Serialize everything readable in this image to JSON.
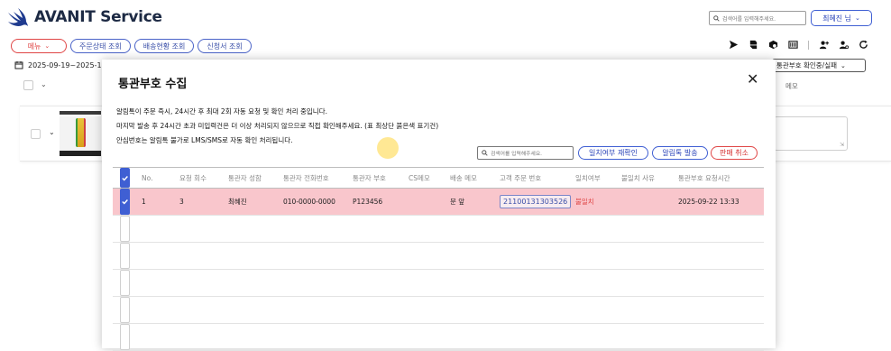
{
  "header": {
    "app_title": "AVANIT Service",
    "search_placeholder": "검색어를 입력해주세요.",
    "user_label": "최혜진 님"
  },
  "nav": {
    "menu_label": "메뉴",
    "pills": [
      "주문상태 조회",
      "배송현황 조회",
      "신청서 조회"
    ]
  },
  "toolbar": {
    "icons": [
      "send-icon",
      "print-icon",
      "package-search-icon",
      "barcode-icon",
      "user-add-icon",
      "user-settings-icon",
      "refresh-icon"
    ]
  },
  "filters": {
    "date_range": "2025-09-19~2025-1",
    "status_select": "통관부호 확인중/실패",
    "memo_label": "메모"
  },
  "modal": {
    "title": "통관부호 수집",
    "notices": [
      "알림톡이 주문 즉시, 24시간 후 최대 2회 자동 요청 및 확인 처리 중입니다.",
      "마지막 발송 후 24시간 초과 미입력건은 더 이상 처리되지 않으므로 직접 확인해주세요. (표 최상단 붉은색 표기건)",
      "안심번호는 알림톡 불가로 LMS/SMS로 자동 확인 처리됩니다."
    ],
    "search_placeholder": "검색어를 입력해주세요.",
    "buttons": {
      "recheck": "일치여부 재확인",
      "send_alimtalk": "알림톡 발송",
      "cancel_sale": "판매 취소"
    },
    "columns": [
      "No.",
      "요청 회수",
      "통관자 성함",
      "통관자 전화번호",
      "통관자 부호",
      "CS메모",
      "배송 메모",
      "고객 주문 번호",
      "일치여부",
      "불일치 사유",
      "통관부호 요청시간"
    ],
    "rows": [
      {
        "checked": true,
        "no": "1",
        "request_count": "3",
        "name": "최혜진",
        "phone": "010-0000-0000",
        "code": "P123456",
        "cs_memo": "",
        "delivery_memo": "문 앞",
        "order_no": "21100131303526",
        "match": "불일치",
        "mismatch_reason": "",
        "requested_at": "2025-09-22 13:33"
      }
    ]
  }
}
